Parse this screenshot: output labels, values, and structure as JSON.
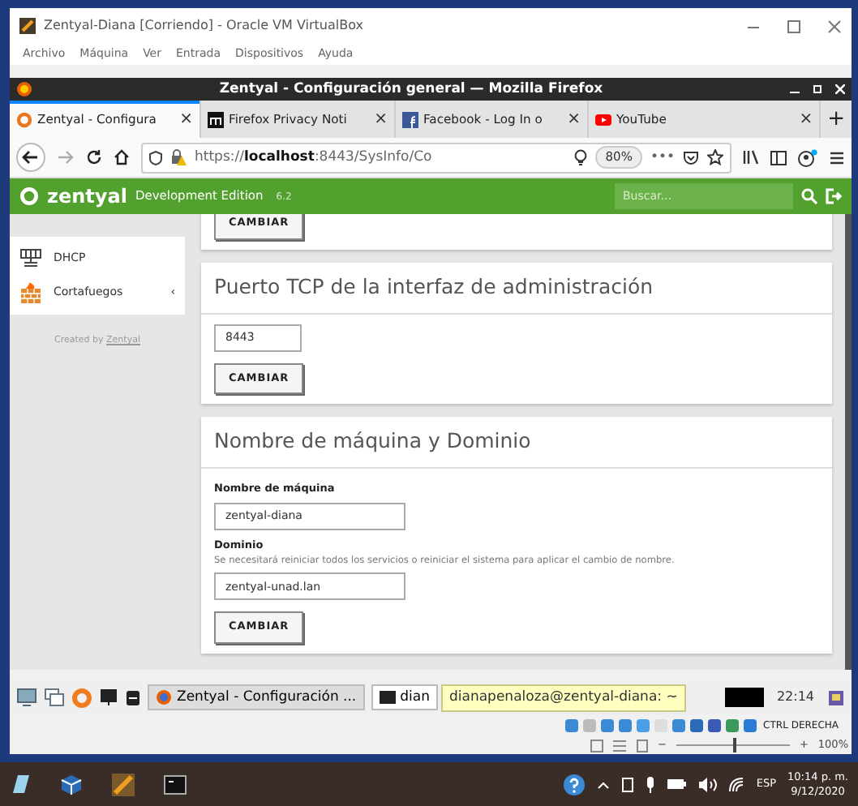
{
  "vbox_window": {
    "title": "Zentyal-Diana [Corriendo] - Oracle VM VirtualBox",
    "menu": [
      "Archivo",
      "Máquina",
      "Ver",
      "Entrada",
      "Dispositivos",
      "Ayuda"
    ]
  },
  "firefox": {
    "title": "Zentyal - Configuración general — Mozilla Firefox",
    "tabs": [
      {
        "label": "Zentyal - Configura",
        "kind": "zentyal",
        "selected": true,
        "close": "×"
      },
      {
        "label": "Firefox Privacy Noti",
        "kind": "privacy",
        "selected": false,
        "close": "×"
      },
      {
        "label": "Facebook - Log In o",
        "kind": "facebook",
        "selected": false,
        "close": "×"
      },
      {
        "label": "YouTube",
        "kind": "youtube",
        "selected": false,
        "close": "×"
      }
    ],
    "new_tab": "+",
    "url": "https://**localhost**:8443/SysInfo/Co",
    "zoom": "80%",
    "more": "•••"
  },
  "zentyal": {
    "brand": "zentyal",
    "edition": "Development Edition",
    "version": "6.2",
    "search_placeholder": "Buscar...",
    "sidebar": [
      {
        "label": "DHCP",
        "kind": "dhcp"
      },
      {
        "label": "Cortafuegos",
        "kind": "firewall",
        "expander": "‹"
      }
    ],
    "credit": "Created by",
    "credit_link": "Zentyal",
    "panels": [
      {
        "kind": "partial",
        "button": "CAMBIAR"
      },
      {
        "kind": "form",
        "title": "Puerto TCP de la interfaz de administración",
        "fields": [
          {
            "value": "8443"
          }
        ],
        "button": "CAMBIAR"
      },
      {
        "kind": "form",
        "title": "Nombre de máquina y Dominio",
        "fields": [
          {
            "label": "Nombre de máquina",
            "value": "zentyal-diana"
          },
          {
            "label": "Dominio",
            "help": "Se necesitará reiniciar todos los servicios o reiniciar el sistema para aplicar el cambio de nombre.",
            "value": "zentyal-unad.lan"
          }
        ],
        "button": "CAMBIAR"
      }
    ]
  },
  "guest_taskbar": {
    "tasks": [
      {
        "label": "Zentyal - Configuración ...",
        "kind": "firefox",
        "selected": true
      },
      {
        "label": "dian",
        "kind": "terminal",
        "selected": false
      }
    ],
    "tooltip": "dianapenaloza@zentyal-diana: ~",
    "clock": "22:14"
  },
  "vbox_status": {
    "host_key": "CTRL DERECHA",
    "zoom_minus": "−",
    "zoom_plus": "+",
    "zoom_value": "100%",
    "level": 0.5
  },
  "windows_taskbar": {
    "language": "ESP",
    "time": "10:14 p. m.",
    "date": "9/12/2020"
  }
}
